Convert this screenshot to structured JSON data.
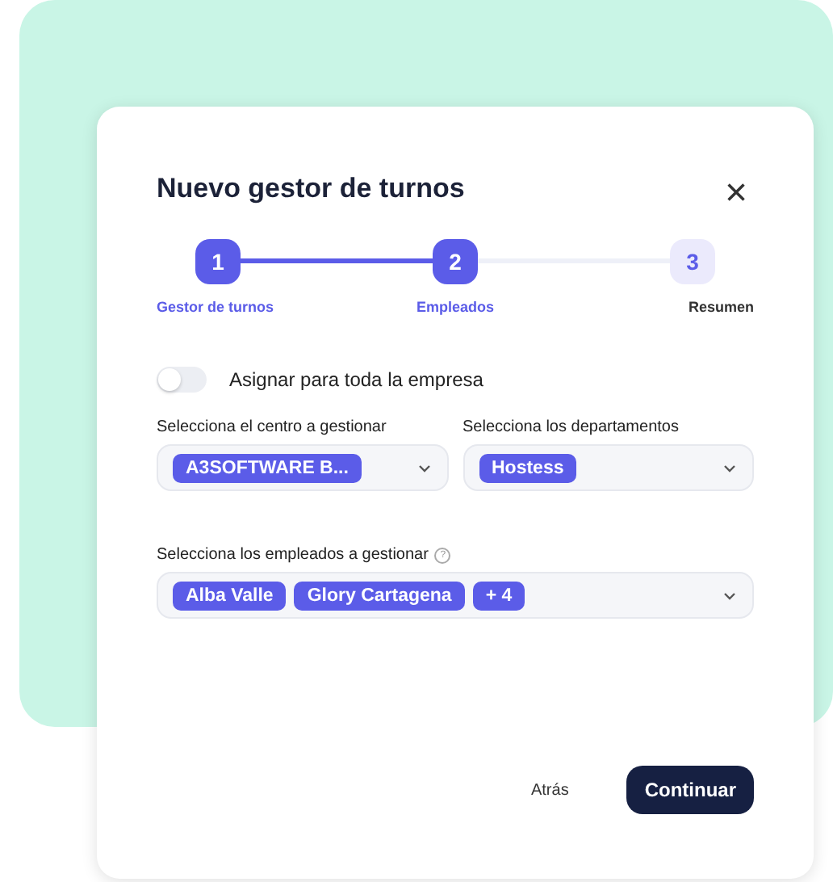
{
  "dialog": {
    "title": "Nuevo gestor de turnos",
    "close": "×"
  },
  "steps": [
    {
      "number": "1",
      "label": "Gestor de turnos",
      "reached": true
    },
    {
      "number": "2",
      "label": "Empleados",
      "reached": true
    },
    {
      "number": "3",
      "label": "Resumen",
      "reached": false
    }
  ],
  "company_toggle": {
    "label": "Asignar para toda la empresa",
    "on": false
  },
  "selects": [
    {
      "label": "Selecciona el centro a gestionar",
      "chips": [
        "A3SOFTWARE B..."
      ]
    },
    {
      "label": "Selecciona los departamentos",
      "chips": [
        "Hostess"
      ]
    }
  ],
  "employees": {
    "label": "Selecciona los empleados a gestionar",
    "help": "?",
    "chips": [
      "Alba Valle",
      "Glory Cartagena",
      "+ 4"
    ]
  },
  "buttons": {
    "back": "Atrás",
    "next": "Continuar"
  }
}
